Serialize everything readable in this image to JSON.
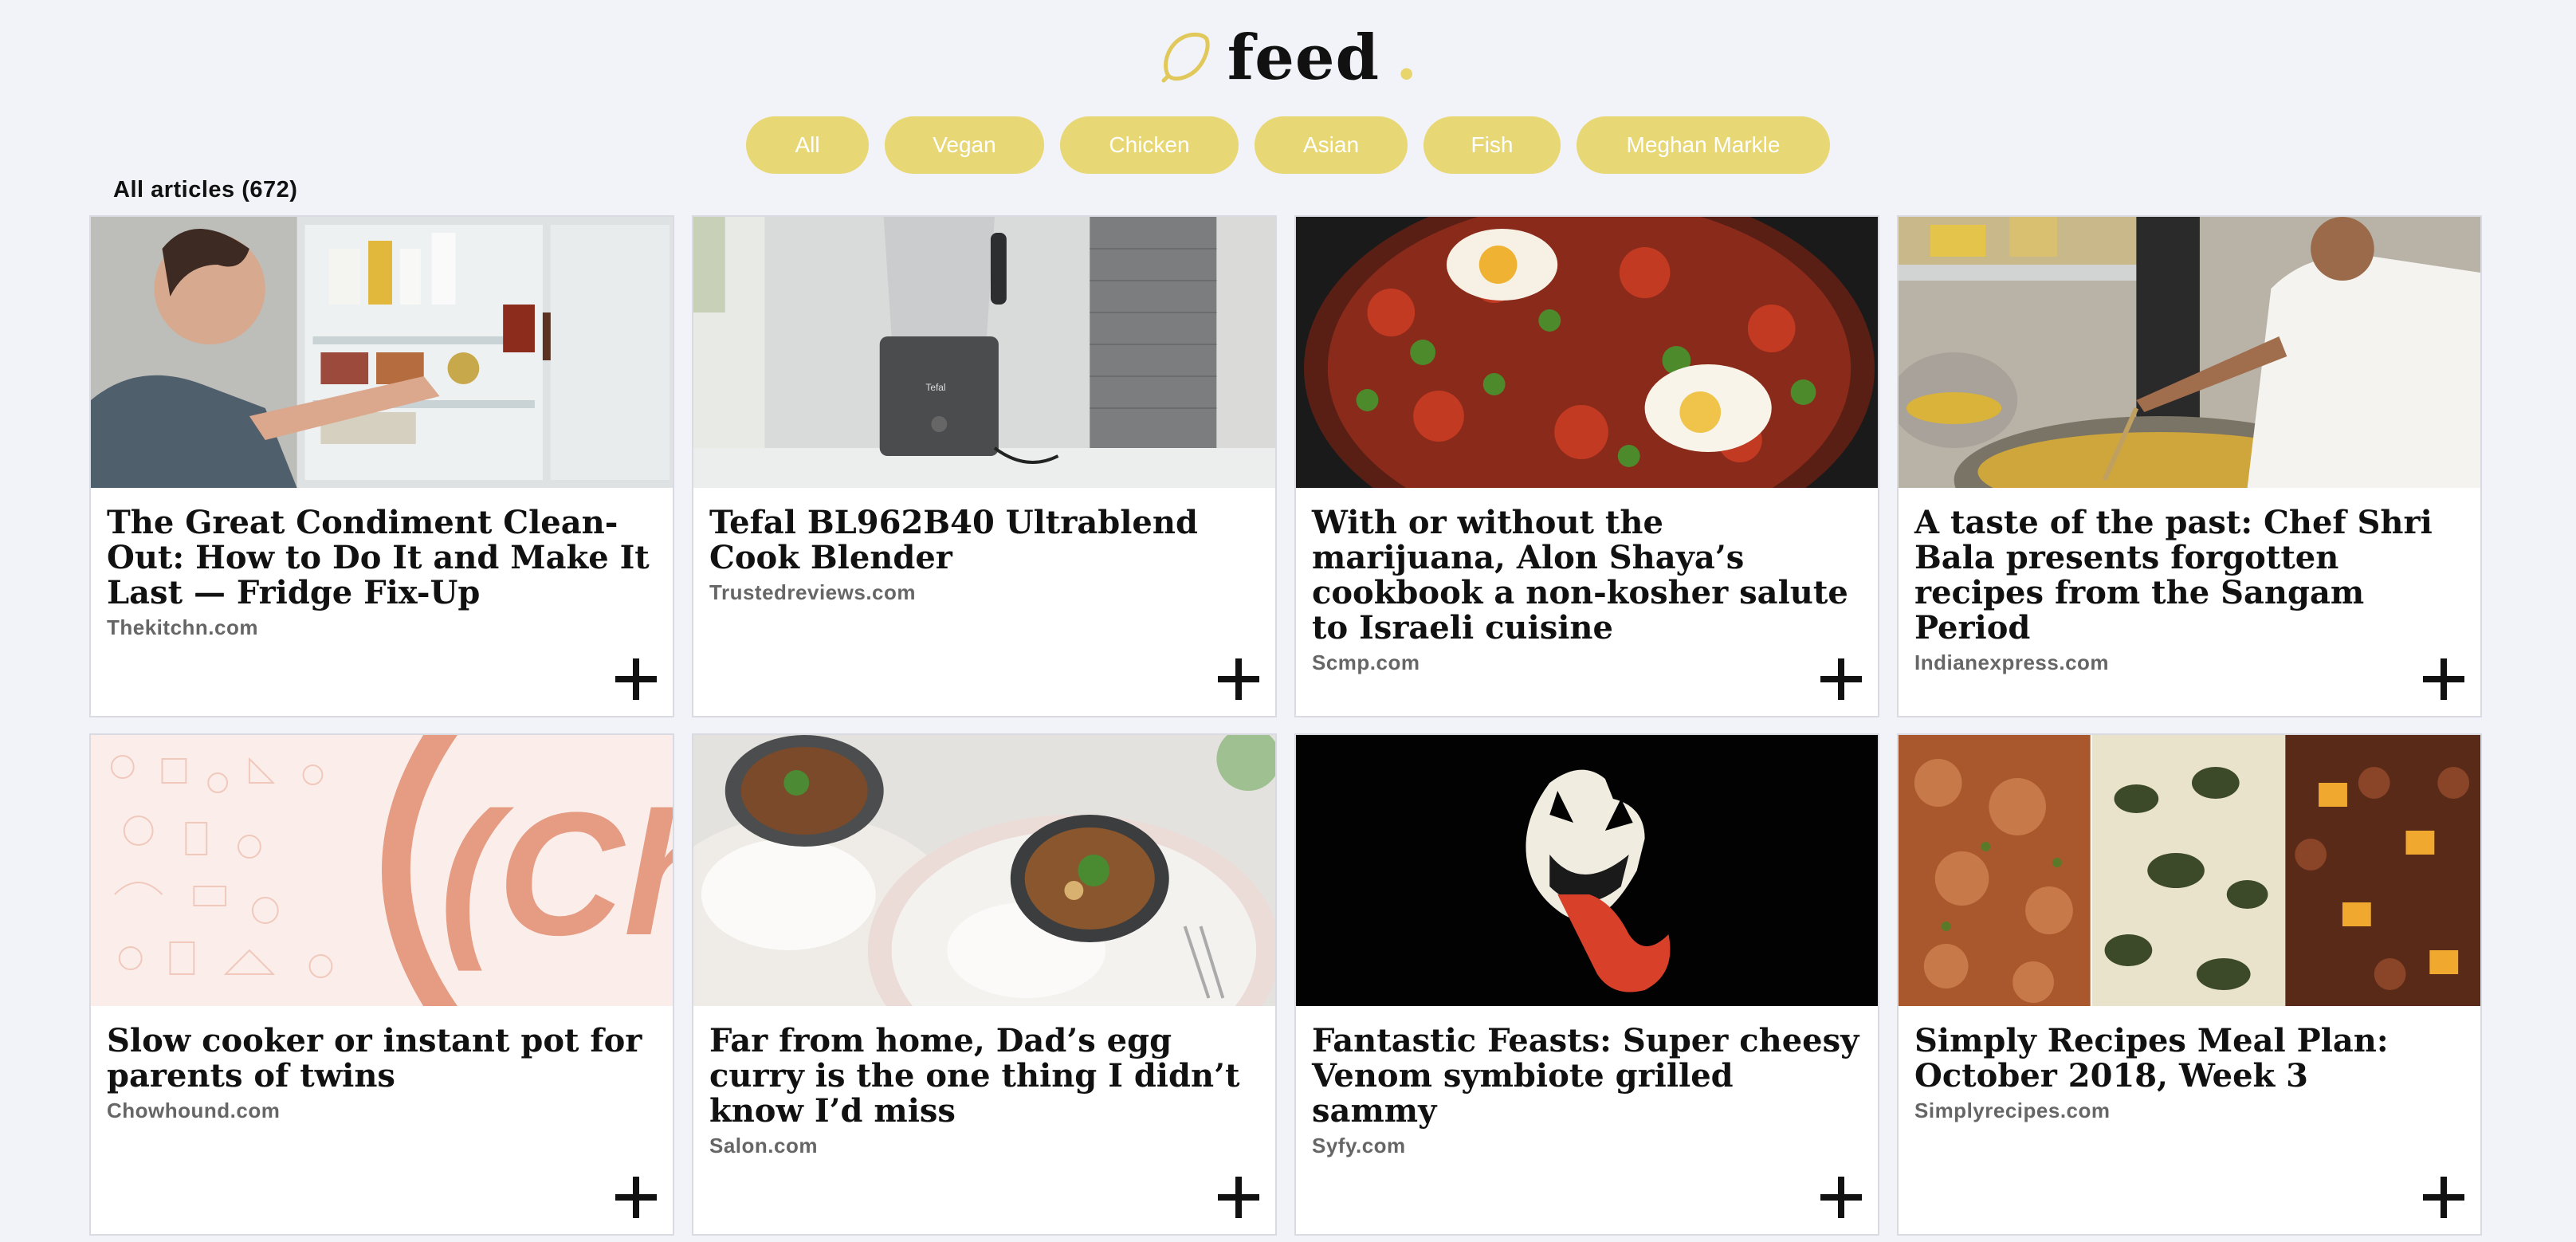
{
  "brand": {
    "name": "feed",
    "dot": ".",
    "accent_color": "#e8d56b",
    "icon": "lemon-icon"
  },
  "filters": [
    "All",
    "Vegan",
    "Chicken",
    "Asian",
    "Fish",
    "Meghan Markle"
  ],
  "articles_count_label": "All articles (672)",
  "articles": [
    {
      "title": "The Great Condiment Clean-Out: How to Do It and Make It Last — Fridge Fix-Up",
      "source": "Thekitchn.com",
      "image": "woman opening refrigerator"
    },
    {
      "title": "Tefal BL962B40 Ultrablend Cook Blender",
      "source": "Trustedreviews.com",
      "image": "blender on kitchen counter"
    },
    {
      "title": "With or without the marijuana, Alon Shaya’s cookbook a non-kosher salute to Israeli cuisine",
      "source": "Scmp.com",
      "image": "shakshuka in pan"
    },
    {
      "title": "A taste of the past: Chef Shri Bala presents forgotten recipes from the Sangam Period",
      "source": "Indianexpress.com",
      "image": "chef cooking in large pot"
    },
    {
      "title": "Slow cooker or instant pot for parents of twins",
      "source": "Chowhound.com",
      "image": "Chowhound logo pattern"
    },
    {
      "title": "Far from home, Dad’s egg curry is the one thing I didn’t know I’d miss",
      "source": "Salon.com",
      "image": "egg curry with rice"
    },
    {
      "title": "Fantastic Feasts: Super cheesy Venom symbiote grilled sammy",
      "source": "Syfy.com",
      "image": "venom shaped sandwich"
    },
    {
      "title": "Simply Recipes Meal Plan: October 2018, Week 3",
      "source": "Simplyrecipes.com",
      "image": "three meal photos"
    }
  ],
  "thumb_text": {
    "blender_brand": "Tefal",
    "chowhound_mark": "(Ch"
  }
}
